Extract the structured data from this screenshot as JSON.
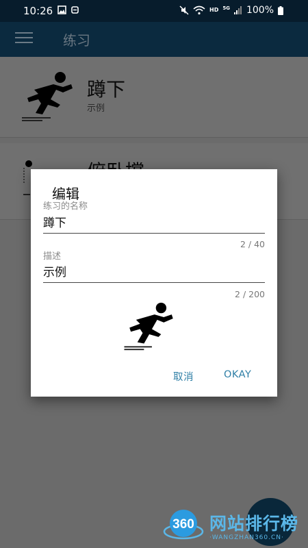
{
  "status_bar": {
    "time": "10:26",
    "battery": "100%",
    "network_hd": "HD",
    "network_5g": "5G",
    "icons": [
      "image-icon",
      "sync-icon",
      "mute-icon",
      "wifi-icon",
      "signal-icon",
      "battery-icon"
    ]
  },
  "toolbar": {
    "title": "练习",
    "menu_icon": "hamburger-menu-icon"
  },
  "list": {
    "items": [
      {
        "title": "蹲下",
        "subtitle": "示例"
      },
      {
        "title": "俯卧撑",
        "subtitle": ""
      }
    ]
  },
  "dialog": {
    "title": "编辑",
    "name_label": "练习的名称",
    "name_value": "蹲下",
    "name_counter": "2 / 40",
    "desc_label": "描述",
    "desc_value": "示例",
    "desc_counter": "2 / 200",
    "cancel_label": "取消",
    "ok_label": "OKAY"
  },
  "watermark": {
    "logo_text": "360",
    "text": "网站排行榜",
    "url": "·WANGZHAN360.CN·"
  },
  "colors": {
    "status_bar": "#071c2c",
    "toolbar": "#0b2a3f",
    "accent": "#2f7fa6",
    "watermark": "#5bb7e8"
  }
}
